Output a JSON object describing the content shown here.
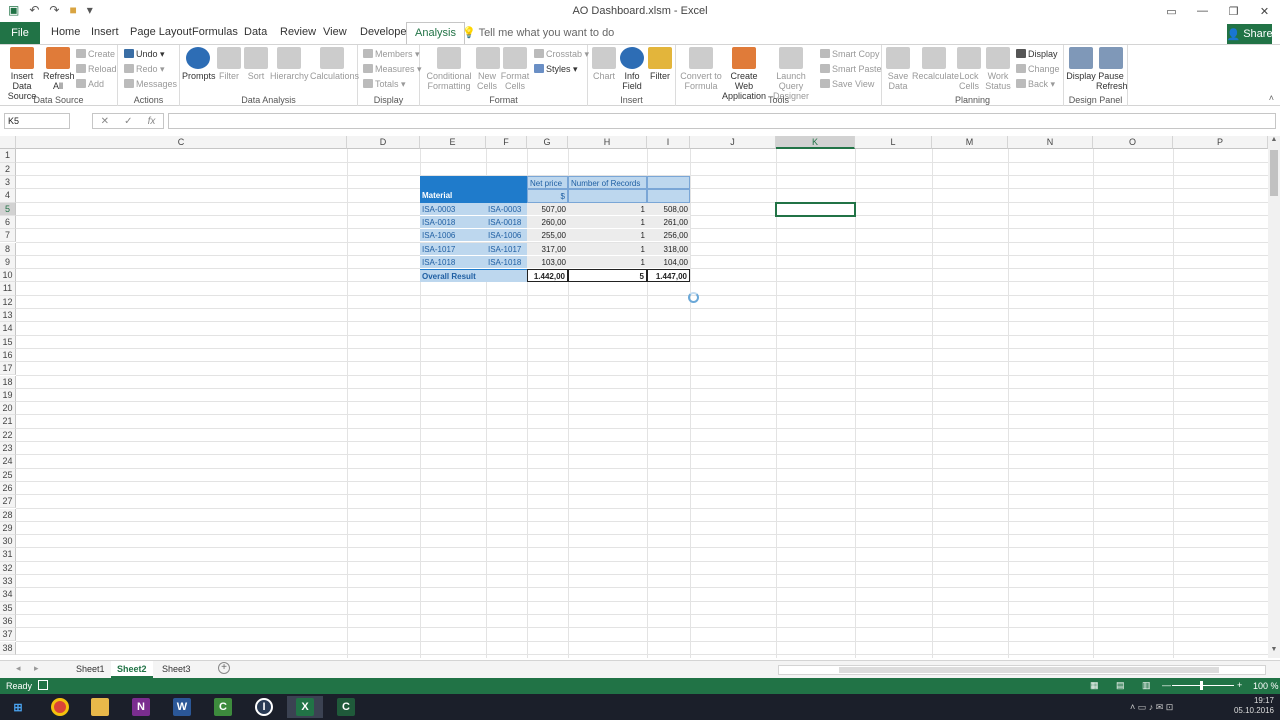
{
  "window": {
    "title": "AO Dashboard.xlsm - Excel",
    "restore_icon": "ribbon-display-icon"
  },
  "tabs": [
    {
      "label": "File"
    },
    {
      "label": "Home"
    },
    {
      "label": "Insert"
    },
    {
      "label": "Page Layout"
    },
    {
      "label": "Formulas"
    },
    {
      "label": "Data"
    },
    {
      "label": "Review"
    },
    {
      "label": "View"
    },
    {
      "label": "Developer"
    },
    {
      "label": "Analysis"
    }
  ],
  "tell_me": "Tell me what you want to do",
  "share": "Share",
  "ribbon": {
    "groups": [
      "Data Source",
      "Actions",
      "Data Analysis",
      "Display",
      "Format",
      "Insert",
      "Tools",
      "Planning",
      "Design Panel"
    ],
    "insert_data_source": "Insert Data Source",
    "refresh_all": "Refresh All",
    "create": "Create",
    "reload": "Reload",
    "add": "Add",
    "undo": "Undo",
    "redo": "Redo",
    "messages": "Messages",
    "prompts": "Prompts",
    "filter": "Filter",
    "sort": "Sort",
    "hierarchy": "Hierarchy",
    "calculations": "Calculations",
    "members": "Members",
    "measures": "Measures",
    "totals": "Totals",
    "conditional_formatting": "Conditional Formatting",
    "new_cells": "New Cells",
    "format_cells": "Format Cells",
    "crosstab": "Crosstab",
    "styles": "Styles",
    "chart": "Chart",
    "info_field": "Info Field",
    "filter2": "Filter",
    "convert_to_formula": "Convert to Formula",
    "create_web_app": "Create Web Application",
    "launch_query": "Launch Query Designer",
    "smart_copy": "Smart Copy",
    "smart_paste": "Smart Paste",
    "save_view": "Save View",
    "save_data": "Save Data",
    "recalculate": "Recalculate",
    "lock_cells": "Lock Cells",
    "work_status": "Work Status",
    "display": "Display",
    "change": "Change",
    "back": "Back",
    "display2": "Display",
    "pause_refresh": "Pause Refresh"
  },
  "formula_bar": {
    "name_box": "K5",
    "formula": ""
  },
  "columns": [
    "C",
    "D",
    "E",
    "F",
    "G",
    "H",
    "I",
    "J",
    "K",
    "L",
    "M",
    "N",
    "O",
    "P"
  ],
  "rows": [
    "1",
    "2",
    "3",
    "4",
    "5",
    "6",
    "7",
    "8",
    "9",
    "10",
    "11",
    "12",
    "13",
    "14",
    "15",
    "16",
    "17",
    "18",
    "19",
    "20",
    "21",
    "22",
    "23",
    "24",
    "25",
    "26",
    "27",
    "28",
    "29",
    "30",
    "31",
    "32",
    "33",
    "34",
    "35",
    "36",
    "37",
    "38"
  ],
  "table": {
    "header_g3": "Net price",
    "header_h3": "Number of Records",
    "material": "Material",
    "unit": "$",
    "rows": [
      {
        "e": "ISA-0003",
        "f": "ISA-0003",
        "g": "507,00",
        "h": "1",
        "i": "508,00"
      },
      {
        "e": "ISA-0018",
        "f": "ISA-0018",
        "g": "260,00",
        "h": "1",
        "i": "261,00"
      },
      {
        "e": "ISA-1006",
        "f": "ISA-1006",
        "g": "255,00",
        "h": "1",
        "i": "256,00"
      },
      {
        "e": "ISA-1017",
        "f": "ISA-1017",
        "g": "317,00",
        "h": "1",
        "i": "318,00"
      },
      {
        "e": "ISA-1018",
        "f": "ISA-1018",
        "g": "103,00",
        "h": "1",
        "i": "104,00"
      }
    ],
    "total": {
      "label": "Overall Result",
      "g": "1.442,00",
      "h": "5",
      "i": "1.447,00"
    }
  },
  "sheets": [
    "Sheet1",
    "Sheet2",
    "Sheet3"
  ],
  "active_sheet": "Sheet2",
  "status": {
    "ready": "Ready",
    "zoom": "100 %"
  },
  "clock": {
    "time": "19:17",
    "date": "05.10.2016"
  },
  "taskbar_apps": [
    "windows-start",
    "chrome",
    "file-explorer",
    "onenote",
    "word",
    "sap-app-green",
    "sap-app-circle",
    "excel",
    "sap-app-dark"
  ]
}
